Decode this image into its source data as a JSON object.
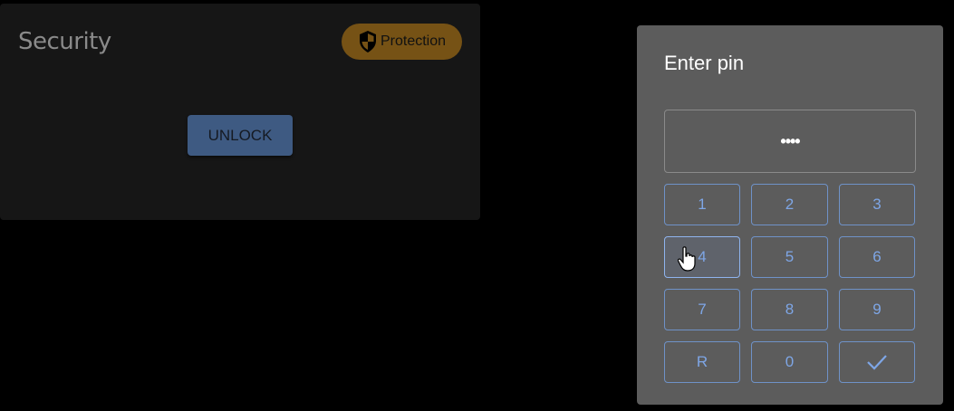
{
  "security_card": {
    "title": "Security",
    "badge_label": "Protection",
    "badge_icon": "shield-icon",
    "unlock_label": "UNLOCK"
  },
  "pin_dialog": {
    "title": "Enter pin",
    "pin_value": "••••",
    "keys": [
      "1",
      "2",
      "3",
      "4",
      "5",
      "6",
      "7",
      "8",
      "9",
      "R",
      "0"
    ],
    "confirm_icon": "check-icon",
    "hovered_key": "4"
  },
  "colors": {
    "badge": "#765215",
    "unlock": "#3e5a82",
    "key_text": "#7ea6e6",
    "dialog_bg": "#5c5c5c"
  }
}
